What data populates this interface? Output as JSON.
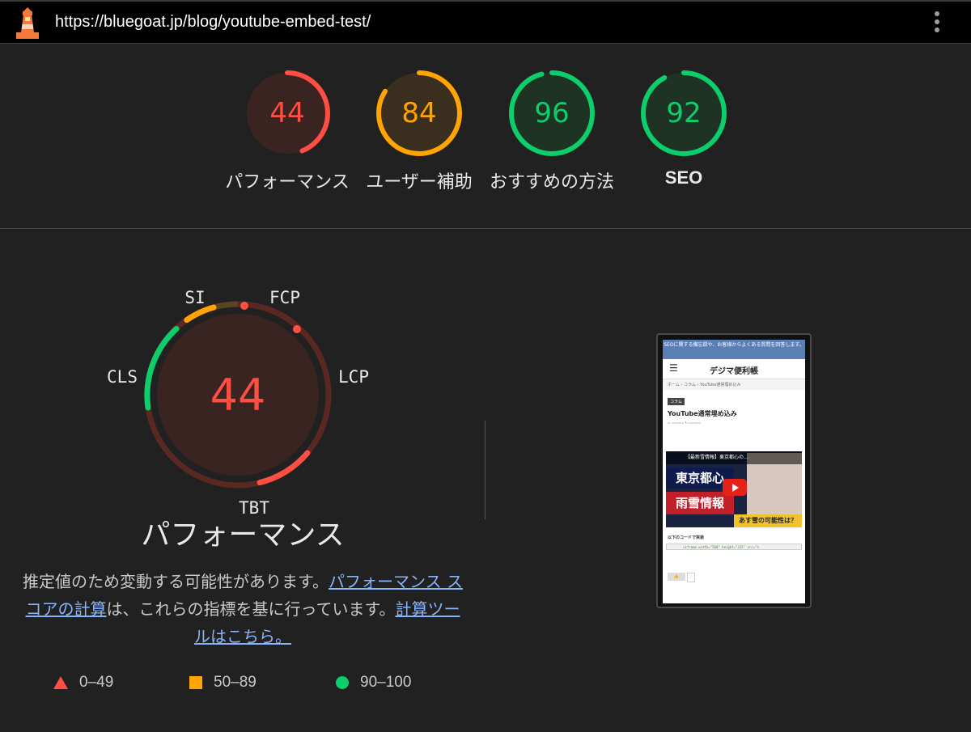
{
  "url": "https://bluegoat.jp/blog/youtube-embed-test/",
  "colors": {
    "fail": "#ff4e42",
    "average": "#ffa400",
    "pass": "#0cce6b",
    "link": "#8ab4f8"
  },
  "categories": [
    {
      "label": "パフォーマンス",
      "score": 44,
      "rating": "fail"
    },
    {
      "label": "ユーザー補助",
      "score": 84,
      "rating": "average"
    },
    {
      "label": "おすすめの方法",
      "score": 96,
      "rating": "pass"
    },
    {
      "label": "SEO",
      "score": 92,
      "rating": "pass"
    }
  ],
  "performance": {
    "score": 44,
    "title": "パフォーマンス",
    "metrics": [
      "FCP",
      "LCP",
      "TBT",
      "CLS",
      "SI"
    ],
    "desc_text1": "推定値のため変動する可能性があります。",
    "desc_link1": "パフォーマンス スコアの計算",
    "desc_text2": "は、これらの指標を基に行っています。",
    "desc_link2": "計算ツールはこちら。"
  },
  "legend": [
    {
      "range": "0–49",
      "shape": "triangle"
    },
    {
      "range": "50–89",
      "shape": "square"
    },
    {
      "range": "90–100",
      "shape": "circle"
    }
  ],
  "thumbnail": {
    "banner": "SEOに関する備忘録や、お客様からよくある質問を回答します。",
    "site_name": "デジマ便利帳",
    "breadcrumb": "ホーム › コラム › YouTube通常埋め込み",
    "tag": "コラム",
    "post_title": "YouTube通常埋め込み",
    "video_header": "【最新雪情報】東京都心の…",
    "video_text1": "東京都心",
    "video_text2": "雨雪情報",
    "video_text3": "あす雪の可能性は？",
    "code_label": "以下のコードで実装",
    "code": "<iframe width=\"560\" height=\"315\" src=\"h",
    "like_count": "0"
  }
}
